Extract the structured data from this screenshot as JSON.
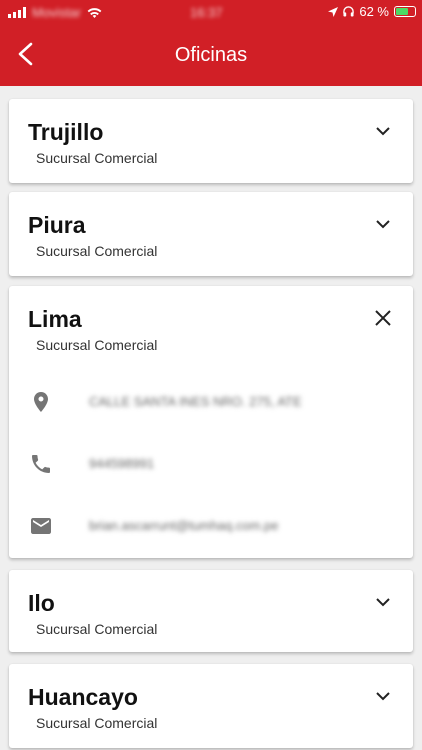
{
  "statusbar": {
    "carrier": "Movistar",
    "time": "16:37",
    "battery": "62 %"
  },
  "header": {
    "title": "Oficinas"
  },
  "offices": [
    {
      "city": "Trujillo",
      "type": "Sucursal Comercial"
    },
    {
      "city": "Piura",
      "type": "Sucursal Comercial"
    },
    {
      "city": "Lima",
      "type": "Sucursal Comercial",
      "address": "CALLE SANTA INES NRO. 275, ATE",
      "phone": "944598991",
      "email": "brian.ascarrunt@tumhaq.com.pe"
    },
    {
      "city": "Ilo",
      "type": "Sucursal Comercial"
    },
    {
      "city": "Huancayo",
      "type": "Sucursal Comercial"
    }
  ],
  "colors": {
    "brand": "#d11f26",
    "background": "#efefef",
    "icon": "#757575"
  }
}
